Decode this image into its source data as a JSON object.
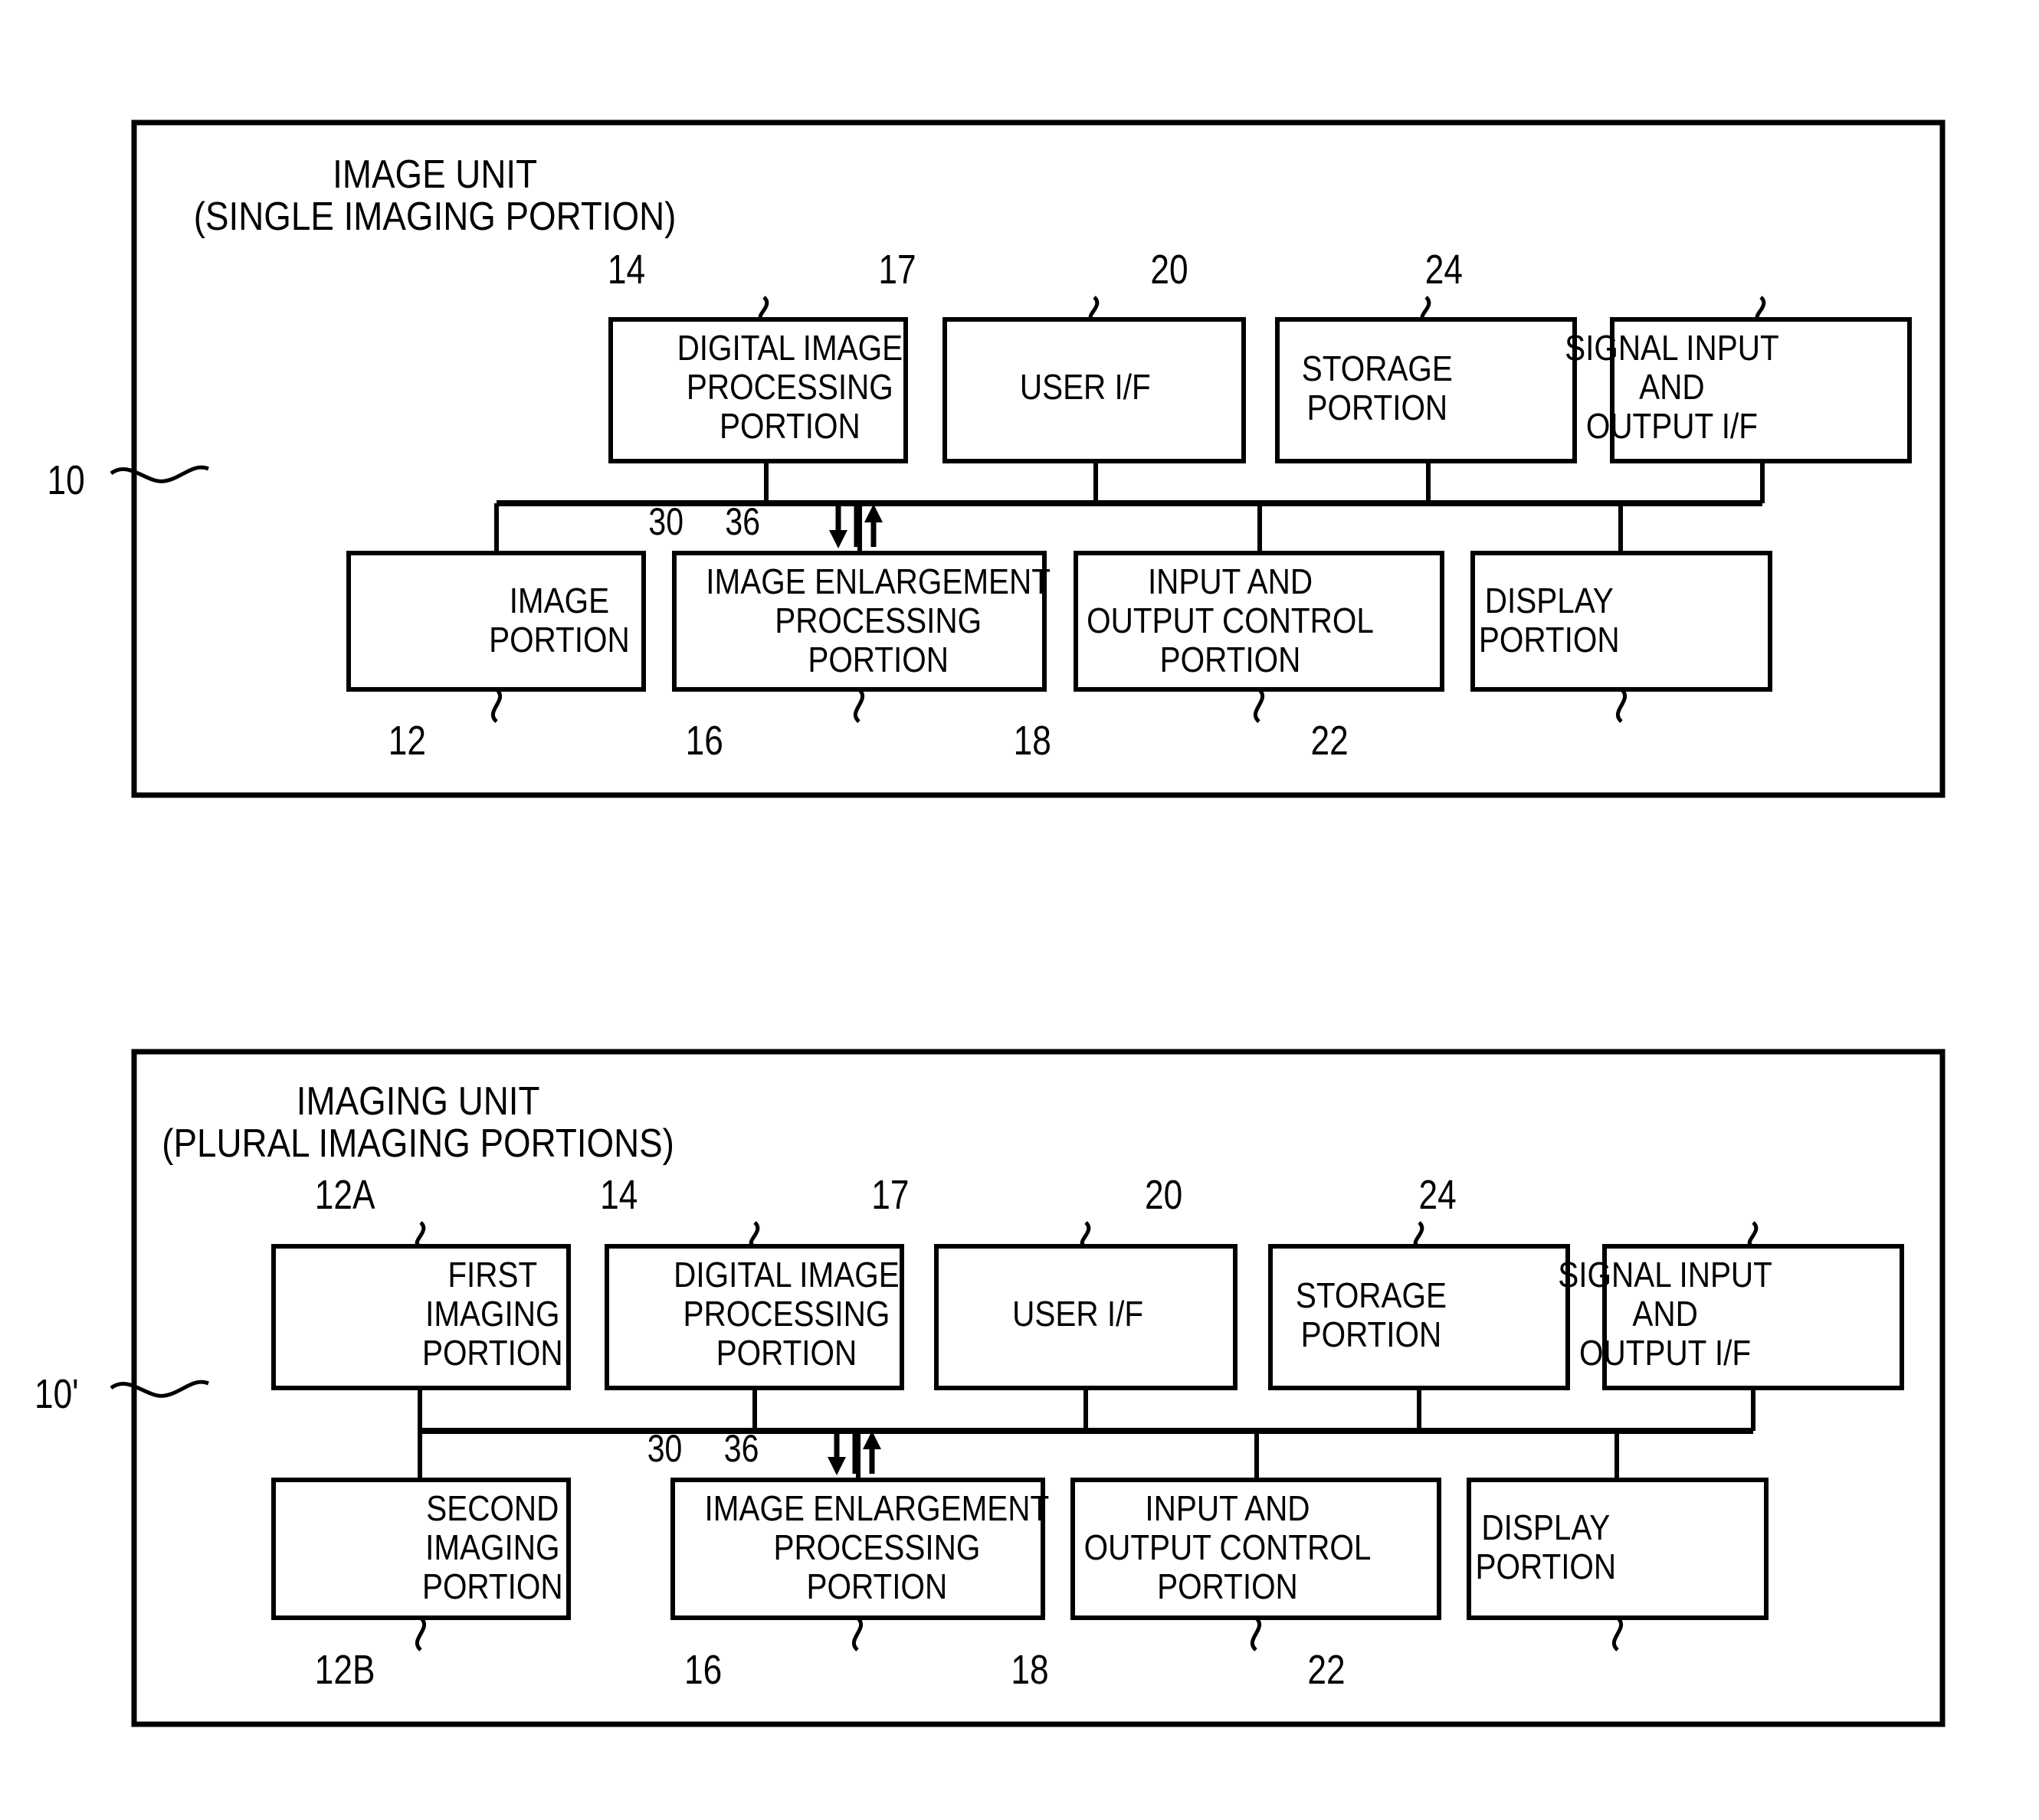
{
  "figures": [
    {
      "id": "figure-1",
      "outer_ref": "10",
      "title_line1": "IMAGE UNIT",
      "title_line2": "(SINGLE IMAGING PORTION)",
      "bus_label": {
        "left_num": "30",
        "right_num": "36",
        "down_arrow": "down-arrow-icon",
        "up_arrow": "up-arrow-icon"
      },
      "top_row": [
        {
          "ref": "14",
          "lines": [
            "DIGITAL IMAGE",
            "PROCESSING",
            "PORTION"
          ],
          "name": "digital-image-processing-portion"
        },
        {
          "ref": "17",
          "lines": [
            "USER I/F"
          ],
          "name": "user-if"
        },
        {
          "ref": "20",
          "lines": [
            "STORAGE",
            "PORTION"
          ],
          "name": "storage-portion"
        },
        {
          "ref": "24",
          "lines": [
            "SIGNAL INPUT",
            "AND",
            "OUTPUT I/F"
          ],
          "name": "signal-input-and-output-if"
        }
      ],
      "bottom_row": [
        {
          "ref": "12",
          "lines": [
            "IMAGE",
            "PORTION"
          ],
          "name": "image-portion"
        },
        {
          "ref": "16",
          "lines": [
            "IMAGE ENLARGEMENT",
            "PROCESSING",
            "PORTION"
          ],
          "name": "image-enlargement-processing-portion"
        },
        {
          "ref": "18",
          "lines": [
            "INPUT AND",
            "OUTPUT CONTROL",
            "PORTION"
          ],
          "name": "input-and-output-control-portion"
        },
        {
          "ref": "22",
          "lines": [
            "DISPLAY",
            "PORTION"
          ],
          "name": "display-portion"
        }
      ]
    },
    {
      "id": "figure-2",
      "outer_ref": "10'",
      "title_line1": "IMAGING UNIT",
      "title_line2": "(PLURAL IMAGING PORTIONS)",
      "bus_label": {
        "left_num": "30",
        "right_num": "36",
        "down_arrow": "down-arrow-icon",
        "up_arrow": "up-arrow-icon"
      },
      "top_row": [
        {
          "ref": "12A",
          "lines": [
            "FIRST",
            "IMAGING",
            "PORTION"
          ],
          "name": "first-imaging-portion"
        },
        {
          "ref": "14",
          "lines": [
            "DIGITAL IMAGE",
            "PROCESSING",
            "PORTION"
          ],
          "name": "digital-image-processing-portion"
        },
        {
          "ref": "17",
          "lines": [
            "USER I/F"
          ],
          "name": "user-if"
        },
        {
          "ref": "20",
          "lines": [
            "STORAGE",
            "PORTION"
          ],
          "name": "storage-portion"
        },
        {
          "ref": "24",
          "lines": [
            "SIGNAL INPUT",
            "AND",
            "OUTPUT I/F"
          ],
          "name": "signal-input-and-output-if"
        }
      ],
      "bottom_row": [
        {
          "ref": "12B",
          "lines": [
            "SECOND",
            "IMAGING",
            "PORTION"
          ],
          "name": "second-imaging-portion"
        },
        {
          "ref": "16",
          "lines": [
            "IMAGE ENLARGEMENT",
            "PROCESSING",
            "PORTION"
          ],
          "name": "image-enlargement-processing-portion"
        },
        {
          "ref": "18",
          "lines": [
            "INPUT AND",
            "OUTPUT CONTROL",
            "PORTION"
          ],
          "name": "input-and-output-control-portion"
        },
        {
          "ref": "22",
          "lines": [
            "DISPLAY",
            "PORTION"
          ],
          "name": "display-portion"
        }
      ]
    }
  ],
  "colors": {
    "ink": "#000000",
    "paper": "#ffffff"
  }
}
